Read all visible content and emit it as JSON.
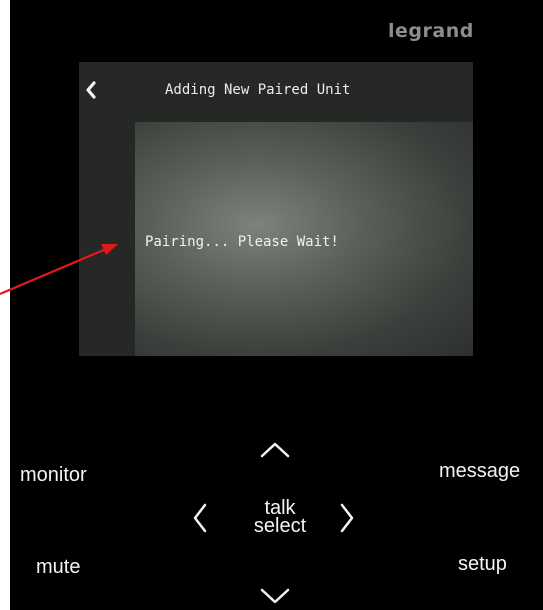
{
  "brand": {
    "logo_text": "legrand"
  },
  "screen": {
    "title": "Adding New Paired Unit",
    "status_text": "Pairing... Please Wait!"
  },
  "buttons": {
    "monitor": "monitor",
    "message": "message",
    "mute": "mute",
    "setup": "setup",
    "talk": "talk",
    "select": "select"
  },
  "icons": {
    "back": "chevron-left-icon",
    "up": "chevron-up-icon",
    "down": "chevron-down-icon",
    "left": "chevron-left-icon",
    "right": "chevron-right-icon"
  },
  "colors": {
    "device_body": "#000000",
    "screen_bg": "#262826",
    "brand": "#8d8d8d",
    "annotation_arrow": "#e0191b"
  }
}
